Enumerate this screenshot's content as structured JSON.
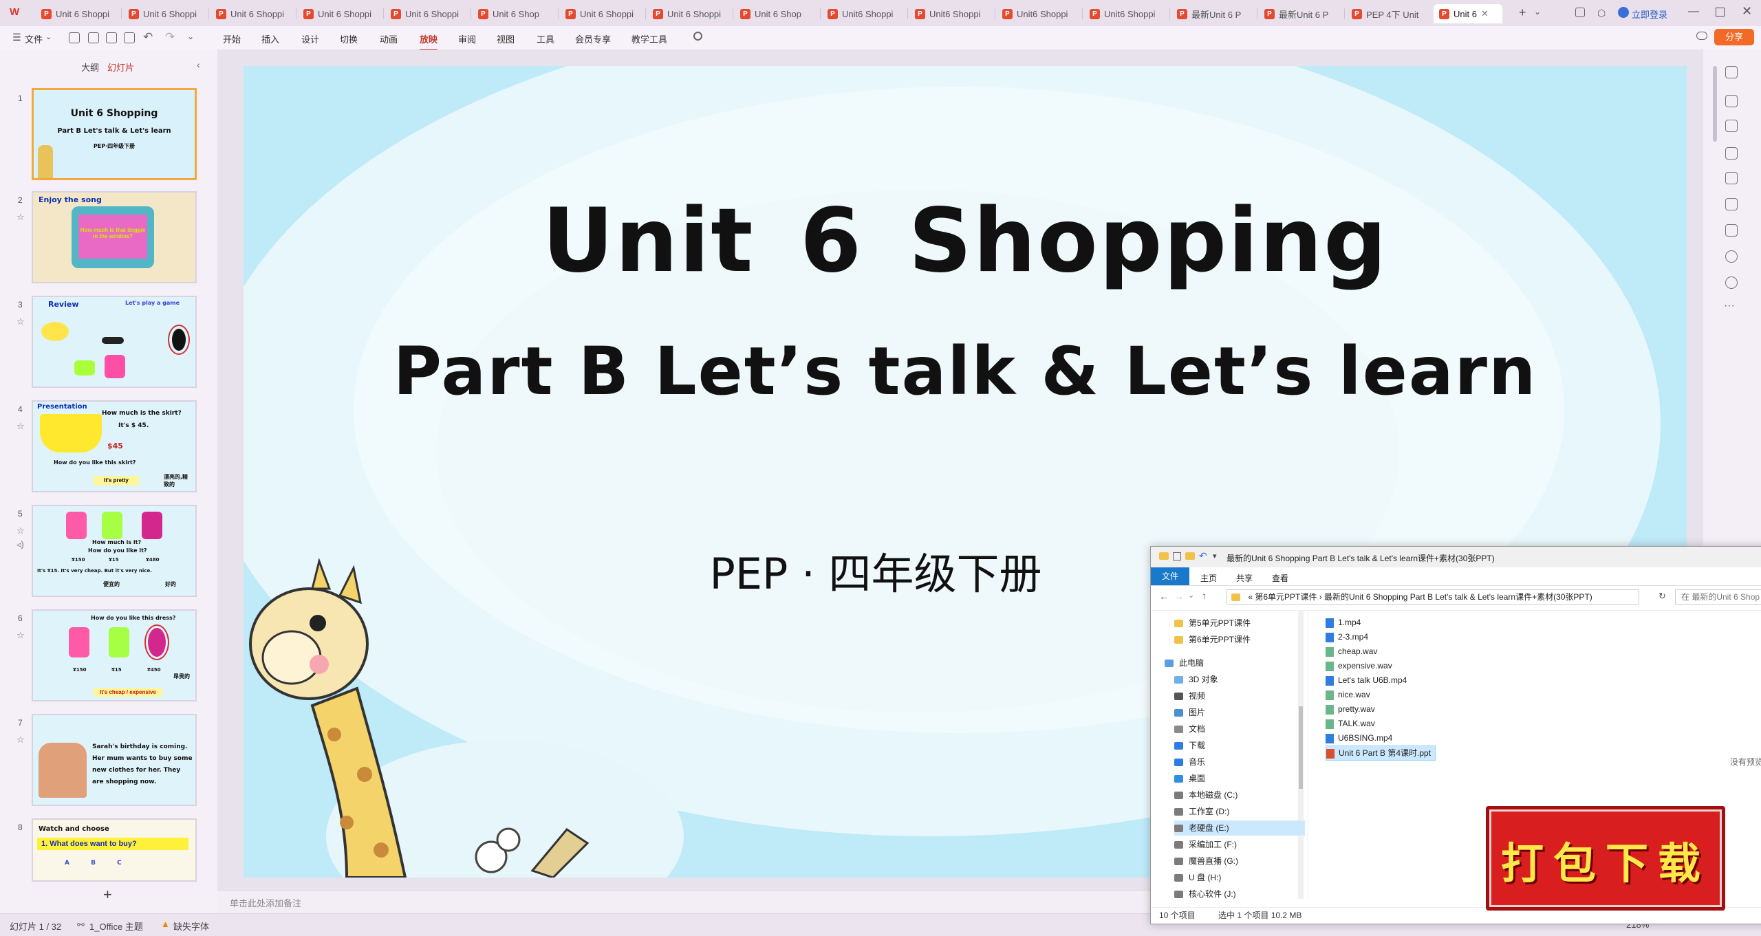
{
  "app": {
    "logo": "W"
  },
  "tabs": [
    {
      "label": "Unit 6 Shoppi"
    },
    {
      "label": "Unit 6 Shoppi"
    },
    {
      "label": "Unit 6 Shoppi"
    },
    {
      "label": "Unit 6 Shoppi"
    },
    {
      "label": "Unit 6 Shoppi"
    },
    {
      "label": "Unit 6 Shop"
    },
    {
      "label": "Unit 6 Shoppi"
    },
    {
      "label": "Unit 6 Shoppi"
    },
    {
      "label": "Unit 6 Shop"
    },
    {
      "label": "Unit6 Shoppi"
    },
    {
      "label": "Unit6 Shoppi"
    },
    {
      "label": "Unit6 Shoppi"
    },
    {
      "label": "Unit6 Shoppi"
    },
    {
      "label": "最新Unit 6  P"
    },
    {
      "label": "最新Unit 6  P"
    },
    {
      "label": "PEP 4下 Unit"
    },
    {
      "label": "Unit 6"
    }
  ],
  "titlebar": {
    "login": "立即登录",
    "share": "分享"
  },
  "ribbon": {
    "file": "文件",
    "menus": [
      "开始",
      "插入",
      "设计",
      "切换",
      "动画",
      "放映",
      "审阅",
      "视图",
      "工具",
      "会员专享",
      "教学工具"
    ],
    "active_index": 5
  },
  "panel": {
    "tab_outline": "大纲",
    "tab_slides": "幻灯片",
    "add": "+"
  },
  "thumbs": [
    {
      "num": "1",
      "title": "Unit 6   Shopping",
      "sub": "Part B Let's talk & Let's learn",
      "sub2": "PEP·四年级下册"
    },
    {
      "num": "2",
      "label": "Enjoy the song",
      "screen": "How much is that doggie in the window?"
    },
    {
      "num": "3",
      "label": "Review",
      "top": "Let's play a game"
    },
    {
      "num": "4",
      "label": "Presentation",
      "q": "How much is the skirt?",
      "a": "It's $ 45.",
      "price": "$45",
      "q2": "How do you like this skirt?",
      "fill": "It's pretty",
      "cn": "漂亮的,精致的"
    },
    {
      "num": "5",
      "q": "How much is it?",
      "q2": "How do you like it?",
      "p1": "¥150",
      "p2": "¥15",
      "p3": "¥480",
      "line": "It's ¥15. It's very cheap. But it's very nice.",
      "cn1": "便宜的",
      "cn2": "好的"
    },
    {
      "num": "6",
      "q": "How do you like this dress?",
      "p1": "¥150",
      "p2": "¥15",
      "p3": "¥450",
      "line": "It's cheap / expensive",
      "cn": "昂贵的"
    },
    {
      "num": "7",
      "text": "Sarah's birthday is coming. Her mum wants to buy some new clothes for her. They are shopping now."
    },
    {
      "num": "8",
      "label": "Watch and choose",
      "q": "1. What does  want to buy?",
      "opts": "A  B  C"
    }
  ],
  "slide": {
    "title": "Unit 6   Shopping",
    "subtitle": "Part B Let’s talk & Let’s learn",
    "grade": "PEP · 四年级下册"
  },
  "notes": {
    "placeholder": "单击此处添加备注"
  },
  "status": {
    "slide_counter": "幻灯片 1 / 32",
    "theme": "1_Office 主题",
    "missing_font": "缺失字体",
    "zoom": "218%"
  },
  "explorer": {
    "title": "最新的Unit 6 Shopping Part B Let's talk & Let's learn课件+素材(30张PPT)",
    "ribbon_tabs": [
      "文件",
      "主页",
      "共享",
      "查看"
    ],
    "address": "« 第6单元PPT课件 › 最新的Unit 6 Shopping Part B Let's talk & Let's learn课件+素材(30张PPT)",
    "search_placeholder": "在 最新的Unit 6 Shop",
    "nav": [
      {
        "label": "第5单元PPT课件",
        "type": "folder"
      },
      {
        "label": "第6单元PPT课件",
        "type": "folder"
      },
      {
        "label": "此电脑",
        "type": "pc"
      },
      {
        "label": "3D 对象",
        "type": "3d"
      },
      {
        "label": "视频",
        "type": "video"
      },
      {
        "label": "图片",
        "type": "pic"
      },
      {
        "label": "文档",
        "type": "doc"
      },
      {
        "label": "下载",
        "type": "down"
      },
      {
        "label": "音乐",
        "type": "music"
      },
      {
        "label": "桌面",
        "type": "desk"
      },
      {
        "label": "本地磁盘 (C:)",
        "type": "drive"
      },
      {
        "label": "工作室 (D:)",
        "type": "drive"
      },
      {
        "label": "老硬盘 (E:)",
        "type": "drive"
      },
      {
        "label": "采编加工 (F:)",
        "type": "drive"
      },
      {
        "label": "魔兽直播 (G:)",
        "type": "drive"
      },
      {
        "label": "U 盘 (H:)",
        "type": "drive"
      },
      {
        "label": "核心软件 (J:)",
        "type": "drive"
      }
    ],
    "files": [
      {
        "name": "1.mp4",
        "type": "video"
      },
      {
        "name": "2-3.mp4",
        "type": "video"
      },
      {
        "name": "cheap.wav",
        "type": "audio"
      },
      {
        "name": "expensive.wav",
        "type": "audio"
      },
      {
        "name": "Let's talk U6B.mp4",
        "type": "video"
      },
      {
        "name": "nice.wav",
        "type": "audio"
      },
      {
        "name": "pretty.wav",
        "type": "audio"
      },
      {
        "name": "TALK.wav",
        "type": "audio"
      },
      {
        "name": "U6BSING.mp4",
        "type": "video"
      },
      {
        "name": "Unit 6 Part B 第4课时.ppt",
        "type": "ppt"
      }
    ],
    "no_preview": "没有预览",
    "status_count": "10 个项目",
    "status_selected": "选中 1 个项目  10.2 MB"
  },
  "badge": {
    "label": "打包下载"
  }
}
